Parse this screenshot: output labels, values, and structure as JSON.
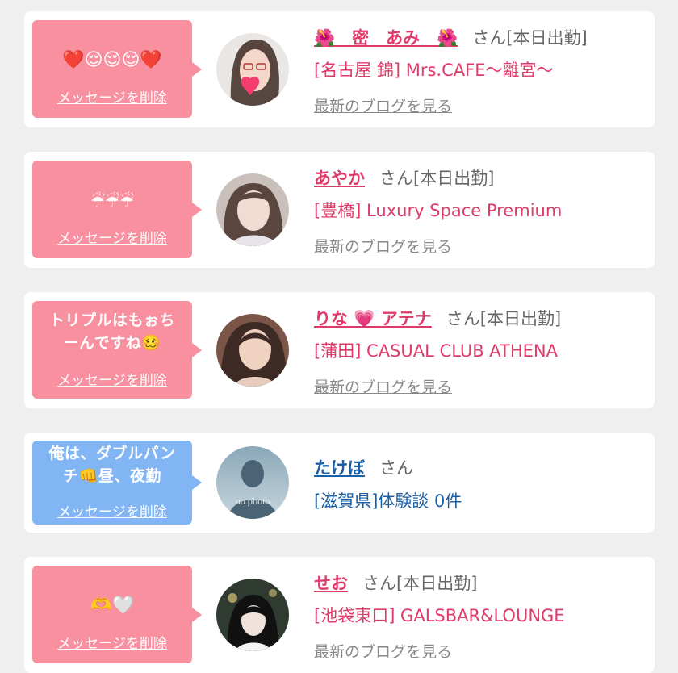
{
  "colors": {
    "page_bg": "#efefef",
    "bubble_pink": "#f8909f",
    "bubble_blue": "#82b5f4",
    "name_pink": "#df3b6a",
    "name_blue": "#1b5fa6",
    "muted": "#888888"
  },
  "delete_label": "メッセージを削除",
  "blog_label": "最新のブログを見る",
  "messages": [
    {
      "bubble_lines": [
        "❤️😌😌😌❤️"
      ],
      "name": "🌺　密　あみ　🌺",
      "san": "さん",
      "status": "[本日出勤]",
      "shop": "[名古屋 錦] Mrs.CAFE〜離宮〜",
      "avatar_icon": "woman-photo-icon"
    },
    {
      "bubble_lines": [
        "☔☔☔"
      ],
      "name": "あやか",
      "san": "さん",
      "status": "[本日出勤]",
      "shop": "[豊橋] Luxury Space Premium",
      "avatar_icon": "woman-photo-icon"
    },
    {
      "bubble_lines": [
        "トリプルはもぉち",
        "ーんですね🥴"
      ],
      "name": "りな 💗 アテナ",
      "san": "さん",
      "status": "[本日出勤]",
      "shop": "[蒲田] CASUAL CLUB ATHENA",
      "avatar_icon": "woman-photo-icon"
    },
    {
      "bubble_lines": [
        "俺は、ダブルパン",
        "チ👊昼、夜勤"
      ],
      "name": "たけぼ",
      "san": "さん",
      "status": "",
      "shop": "[滋賀県]体験談 0件",
      "avatar_icon": "no-photo-icon",
      "avatar_text": "no photo"
    },
    {
      "bubble_lines": [
        "🫶🤍"
      ],
      "name": "せお",
      "san": "さん",
      "status": "[本日出勤]",
      "shop": "[池袋東口] GALSBAR&LOUNGE",
      "avatar_icon": "woman-photo-icon"
    }
  ]
}
